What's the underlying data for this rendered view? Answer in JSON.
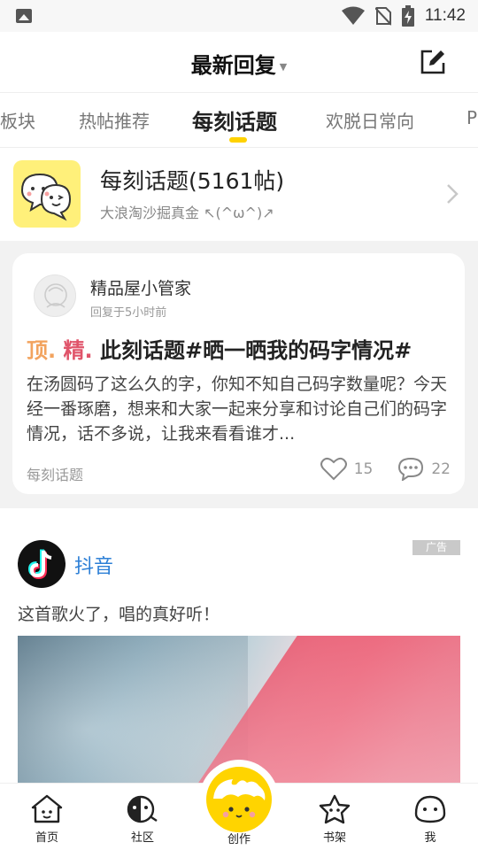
{
  "status_bar": {
    "time": "11:42"
  },
  "header": {
    "title": "最新回复"
  },
  "tabs": [
    {
      "label": "板块"
    },
    {
      "label": "热帖推荐"
    },
    {
      "label": "每刻话题"
    },
    {
      "label": "欢脱日常向"
    },
    {
      "label": "P"
    }
  ],
  "topic": {
    "name": "每刻话题(5161帖)",
    "subtitle": "大浪淘沙掘真金 ↖(^ω^)↗"
  },
  "post": {
    "author": "精品屋小管家",
    "time": "回复于5小时前",
    "tag_top": "顶.",
    "tag_essence": "精.",
    "title": "此刻话题#晒一晒我的码字情况#",
    "body": "在汤圆码了这么久的字，你知不知自己码字数量呢？今天经一番琢磨，想来和大家一起来分享和讨论自己们的码字情况，话不多说，让我来看看谁才...",
    "topic_label": "每刻话题",
    "likes": "15",
    "comments": "22"
  },
  "ad": {
    "badge": "广告",
    "brand": "抖音",
    "slogan": "这首歌火了，唱的真好听！"
  },
  "bottom_nav": [
    {
      "label": "首页"
    },
    {
      "label": "社区"
    },
    {
      "label": "创作"
    },
    {
      "label": "书架"
    },
    {
      "label": "我"
    }
  ],
  "colors": {
    "accent": "#ffd200",
    "top_tag": "#f2a35e",
    "essence_tag": "#e0546a",
    "brand_link": "#2c7fd6"
  }
}
